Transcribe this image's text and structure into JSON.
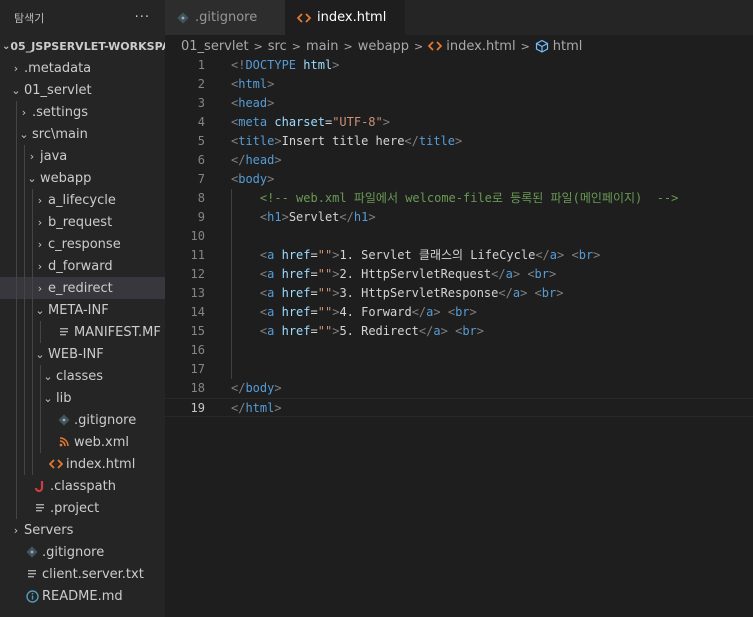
{
  "sidebar": {
    "title": "탐색기",
    "more": "···",
    "root": "05_JSPSERVLET-WORKSPA...",
    "items": [
      {
        "label": ".metadata",
        "depth": 0,
        "chev": ">",
        "icon": "none"
      },
      {
        "label": "01_servlet",
        "depth": 0,
        "chev": "v",
        "icon": "none"
      },
      {
        "label": ".settings",
        "depth": 1,
        "chev": ">",
        "icon": "none"
      },
      {
        "label": "src\\main",
        "depth": 1,
        "chev": "v",
        "icon": "none"
      },
      {
        "label": "java",
        "depth": 2,
        "chev": ">",
        "icon": "none"
      },
      {
        "label": "webapp",
        "depth": 2,
        "chev": "v",
        "icon": "none"
      },
      {
        "label": "a_lifecycle",
        "depth": 3,
        "chev": ">",
        "icon": "none"
      },
      {
        "label": "b_request",
        "depth": 3,
        "chev": ">",
        "icon": "none"
      },
      {
        "label": "c_response",
        "depth": 3,
        "chev": ">",
        "icon": "none"
      },
      {
        "label": "d_forward",
        "depth": 3,
        "chev": ">",
        "icon": "none"
      },
      {
        "label": "e_redirect",
        "depth": 3,
        "chev": ">",
        "icon": "none",
        "selected": true
      },
      {
        "label": "META-INF",
        "depth": 3,
        "chev": "v",
        "icon": "none"
      },
      {
        "label": "MANIFEST.MF",
        "depth": 4,
        "chev": "",
        "icon": "lines"
      },
      {
        "label": "WEB-INF",
        "depth": 3,
        "chev": "v",
        "icon": "none"
      },
      {
        "label": "classes",
        "depth": 4,
        "chev": "v",
        "icon": "none"
      },
      {
        "label": "lib",
        "depth": 4,
        "chev": "v",
        "icon": "none"
      },
      {
        "label": ".gitignore",
        "depth": 4,
        "chev": "",
        "icon": "git"
      },
      {
        "label": "web.xml",
        "depth": 4,
        "chev": "",
        "icon": "rss"
      },
      {
        "label": "index.html",
        "depth": 3,
        "chev": "",
        "icon": "html"
      },
      {
        "label": ".classpath",
        "depth": 1,
        "chev": "",
        "icon": "java"
      },
      {
        "label": ".project",
        "depth": 1,
        "chev": "",
        "icon": "lines"
      },
      {
        "label": "Servers",
        "depth": 0,
        "chev": ">",
        "icon": "none"
      },
      {
        "label": ".gitignore",
        "depth": 0,
        "chev": "",
        "icon": "git"
      },
      {
        "label": "client.server.txt",
        "depth": 0,
        "chev": "",
        "icon": "lines"
      },
      {
        "label": "README.md",
        "depth": 0,
        "chev": "",
        "icon": "info"
      }
    ]
  },
  "tabs": [
    {
      "label": ".gitignore",
      "icon": "git-icon",
      "active": false
    },
    {
      "label": "index.html",
      "icon": "html-icon",
      "active": true,
      "dirty": true
    }
  ],
  "breadcrumb": [
    "01_servlet",
    "src",
    "main",
    "webapp",
    "index.html",
    "html"
  ],
  "editor": {
    "current_line": 19,
    "lines": [
      [
        [
          "punct",
          "<!"
        ],
        [
          "tag",
          "DOCTYPE"
        ],
        [
          "text",
          " "
        ],
        [
          "attr",
          "html"
        ],
        [
          "punct",
          ">"
        ]
      ],
      [
        [
          "punct",
          "<"
        ],
        [
          "tag",
          "html"
        ],
        [
          "punct",
          ">"
        ]
      ],
      [
        [
          "punct",
          "<"
        ],
        [
          "tag",
          "head"
        ],
        [
          "punct",
          ">"
        ]
      ],
      [
        [
          "punct",
          "<"
        ],
        [
          "tag",
          "meta"
        ],
        [
          "text",
          " "
        ],
        [
          "attr",
          "charset"
        ],
        [
          "text",
          "="
        ],
        [
          "str",
          "\"UTF-8\""
        ],
        [
          "punct",
          ">"
        ]
      ],
      [
        [
          "punct",
          "<"
        ],
        [
          "tag",
          "title"
        ],
        [
          "punct",
          ">"
        ],
        [
          "text",
          "Insert title here"
        ],
        [
          "punct",
          "</"
        ],
        [
          "tag",
          "title"
        ],
        [
          "punct",
          ">"
        ]
      ],
      [
        [
          "punct",
          "</"
        ],
        [
          "tag",
          "head"
        ],
        [
          "punct",
          ">"
        ]
      ],
      [
        [
          "punct",
          "<"
        ],
        [
          "tag",
          "body"
        ],
        [
          "punct",
          ">"
        ]
      ],
      [
        [
          "text",
          "    "
        ],
        [
          "comment",
          "<!-- web.xml 파일에서 welcome-file로 등록된 파일(메인페이지)  -->"
        ]
      ],
      [
        [
          "text",
          "    "
        ],
        [
          "punct",
          "<"
        ],
        [
          "tag",
          "h1"
        ],
        [
          "punct",
          ">"
        ],
        [
          "text",
          "Servlet"
        ],
        [
          "punct",
          "</"
        ],
        [
          "tag",
          "h1"
        ],
        [
          "punct",
          ">"
        ]
      ],
      [
        [
          "text",
          "    "
        ]
      ],
      [
        [
          "text",
          "    "
        ],
        [
          "punct",
          "<"
        ],
        [
          "tag",
          "a"
        ],
        [
          "text",
          " "
        ],
        [
          "attr",
          "href"
        ],
        [
          "text",
          "="
        ],
        [
          "str",
          "\"\""
        ],
        [
          "punct",
          ">"
        ],
        [
          "text",
          "1. Servlet 클래스의 LifeCycle"
        ],
        [
          "punct",
          "</"
        ],
        [
          "tag",
          "a"
        ],
        [
          "punct",
          ">"
        ],
        [
          "text",
          " "
        ],
        [
          "punct",
          "<"
        ],
        [
          "tag",
          "br"
        ],
        [
          "punct",
          ">"
        ]
      ],
      [
        [
          "text",
          "    "
        ],
        [
          "punct",
          "<"
        ],
        [
          "tag",
          "a"
        ],
        [
          "text",
          " "
        ],
        [
          "attr",
          "href"
        ],
        [
          "text",
          "="
        ],
        [
          "str",
          "\"\""
        ],
        [
          "punct",
          ">"
        ],
        [
          "text",
          "2. HttpServletRequest"
        ],
        [
          "punct",
          "</"
        ],
        [
          "tag",
          "a"
        ],
        [
          "punct",
          ">"
        ],
        [
          "text",
          " "
        ],
        [
          "punct",
          "<"
        ],
        [
          "tag",
          "br"
        ],
        [
          "punct",
          ">"
        ]
      ],
      [
        [
          "text",
          "    "
        ],
        [
          "punct",
          "<"
        ],
        [
          "tag",
          "a"
        ],
        [
          "text",
          " "
        ],
        [
          "attr",
          "href"
        ],
        [
          "text",
          "="
        ],
        [
          "str",
          "\"\""
        ],
        [
          "punct",
          ">"
        ],
        [
          "text",
          "3. HttpServletResponse"
        ],
        [
          "punct",
          "</"
        ],
        [
          "tag",
          "a"
        ],
        [
          "punct",
          ">"
        ],
        [
          "text",
          " "
        ],
        [
          "punct",
          "<"
        ],
        [
          "tag",
          "br"
        ],
        [
          "punct",
          ">"
        ]
      ],
      [
        [
          "text",
          "    "
        ],
        [
          "punct",
          "<"
        ],
        [
          "tag",
          "a"
        ],
        [
          "text",
          " "
        ],
        [
          "attr",
          "href"
        ],
        [
          "text",
          "="
        ],
        [
          "str",
          "\"\""
        ],
        [
          "punct",
          ">"
        ],
        [
          "text",
          "4. Forward"
        ],
        [
          "punct",
          "</"
        ],
        [
          "tag",
          "a"
        ],
        [
          "punct",
          ">"
        ],
        [
          "text",
          " "
        ],
        [
          "punct",
          "<"
        ],
        [
          "tag",
          "br"
        ],
        [
          "punct",
          ">"
        ]
      ],
      [
        [
          "text",
          "    "
        ],
        [
          "punct",
          "<"
        ],
        [
          "tag",
          "a"
        ],
        [
          "text",
          " "
        ],
        [
          "attr",
          "href"
        ],
        [
          "text",
          "="
        ],
        [
          "str",
          "\"\""
        ],
        [
          "punct",
          ">"
        ],
        [
          "text",
          "5. Redirect"
        ],
        [
          "punct",
          "</"
        ],
        [
          "tag",
          "a"
        ],
        [
          "punct",
          ">"
        ],
        [
          "text",
          " "
        ],
        [
          "punct",
          "<"
        ],
        [
          "tag",
          "br"
        ],
        [
          "punct",
          ">"
        ]
      ],
      [
        [
          "text",
          "    "
        ]
      ],
      [
        [
          "text",
          "    "
        ]
      ],
      [
        [
          "punct",
          "</"
        ],
        [
          "tag",
          "body"
        ],
        [
          "punct",
          ">"
        ]
      ],
      [
        [
          "punct",
          "</"
        ],
        [
          "tag",
          "html"
        ],
        [
          "punct",
          ">"
        ]
      ]
    ]
  }
}
